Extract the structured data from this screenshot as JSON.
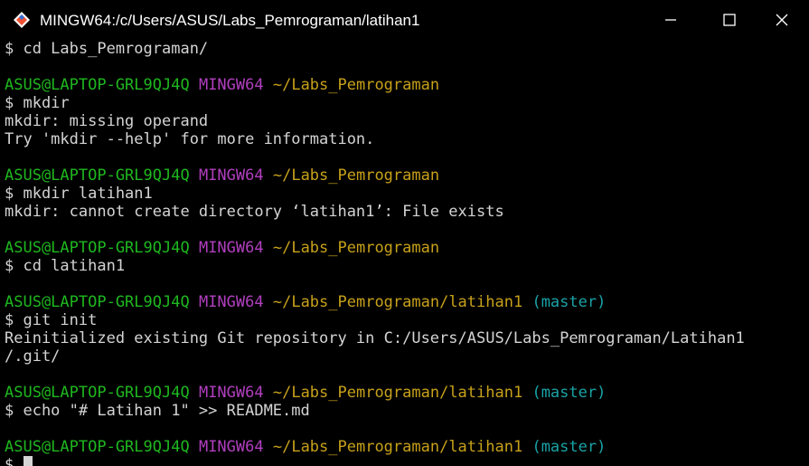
{
  "window": {
    "title": "MINGW64:/c/Users/ASUS/Labs_Pemrograman/latihan1",
    "icons": {
      "app": "git-bash-icon",
      "minimize": "minimize-icon",
      "maximize": "maximize-icon",
      "close": "close-icon"
    }
  },
  "colors": {
    "user": "#1fb71f",
    "mingw": "#b13fbf",
    "path": "#c7a11a",
    "branch": "#1aa3a7",
    "text": "#d4d4d4"
  },
  "terminal": {
    "lines": [
      {
        "type": "cmd",
        "text": "$ cd Labs_Pemrograman/"
      },
      {
        "type": "blank"
      },
      {
        "type": "prompt",
        "user": "ASUS@LAPTOP-GRL9QJ4Q",
        "env": "MINGW64",
        "path": "~/Labs_Pemrograman",
        "branch": ""
      },
      {
        "type": "cmd",
        "text": "$ mkdir"
      },
      {
        "type": "out",
        "text": "mkdir: missing operand"
      },
      {
        "type": "out",
        "text": "Try 'mkdir --help' for more information."
      },
      {
        "type": "blank"
      },
      {
        "type": "prompt",
        "user": "ASUS@LAPTOP-GRL9QJ4Q",
        "env": "MINGW64",
        "path": "~/Labs_Pemrograman",
        "branch": ""
      },
      {
        "type": "cmd",
        "text": "$ mkdir latihan1"
      },
      {
        "type": "out",
        "text": "mkdir: cannot create directory ‘latihan1’: File exists"
      },
      {
        "type": "blank"
      },
      {
        "type": "prompt",
        "user": "ASUS@LAPTOP-GRL9QJ4Q",
        "env": "MINGW64",
        "path": "~/Labs_Pemrograman",
        "branch": ""
      },
      {
        "type": "cmd",
        "text": "$ cd latihan1"
      },
      {
        "type": "blank"
      },
      {
        "type": "prompt",
        "user": "ASUS@LAPTOP-GRL9QJ4Q",
        "env": "MINGW64",
        "path": "~/Labs_Pemrograman/latihan1",
        "branch": "(master)"
      },
      {
        "type": "cmd",
        "text": "$ git init"
      },
      {
        "type": "out",
        "text": "Reinitialized existing Git repository in C:/Users/ASUS/Labs_Pemrograman/Latihan1"
      },
      {
        "type": "out",
        "text": "/.git/"
      },
      {
        "type": "blank"
      },
      {
        "type": "prompt",
        "user": "ASUS@LAPTOP-GRL9QJ4Q",
        "env": "MINGW64",
        "path": "~/Labs_Pemrograman/latihan1",
        "branch": "(master)"
      },
      {
        "type": "cmd",
        "text": "$ echo \"# Latihan 1\" >> README.md"
      },
      {
        "type": "blank"
      },
      {
        "type": "prompt",
        "user": "ASUS@LAPTOP-GRL9QJ4Q",
        "env": "MINGW64",
        "path": "~/Labs_Pemrograman/latihan1",
        "branch": "(master)"
      },
      {
        "type": "cmd",
        "text": "$"
      }
    ]
  }
}
